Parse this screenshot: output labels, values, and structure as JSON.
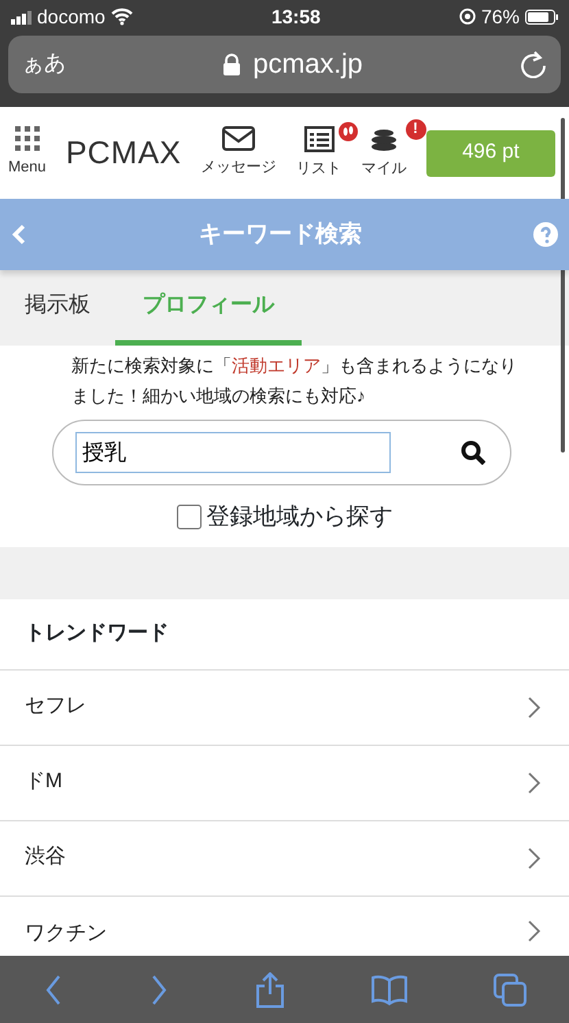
{
  "status_bar": {
    "carrier": "docomo",
    "time": "13:58",
    "battery": "76%"
  },
  "address_bar": {
    "text_size": "ぁあ",
    "url": "pcmax.jp"
  },
  "header": {
    "menu_label": "Menu",
    "logo": "PCMAX",
    "nav": [
      {
        "label": "メッセージ",
        "kind": "message"
      },
      {
        "label": "リスト",
        "kind": "list"
      },
      {
        "label": "マイル",
        "kind": "mile",
        "badge": "!"
      }
    ],
    "points": "496 pt"
  },
  "title_bar": {
    "title": "キーワード検索"
  },
  "tabs": [
    {
      "label": "掲示板",
      "selected": false
    },
    {
      "label": "プロフィール",
      "selected": true
    }
  ],
  "notice": {
    "before": "新たに検索対象に「",
    "highlight": "活動エリア",
    "after": "」も含まれるようになりました！細かい地域の検索にも対応♪"
  },
  "search": {
    "value": "授乳"
  },
  "region_checkbox": {
    "label": "登録地域から探す",
    "checked": false
  },
  "trend": {
    "heading": "トレンドワード",
    "items": [
      "セフレ",
      "ドM",
      "渋谷",
      "ワクチン"
    ]
  }
}
